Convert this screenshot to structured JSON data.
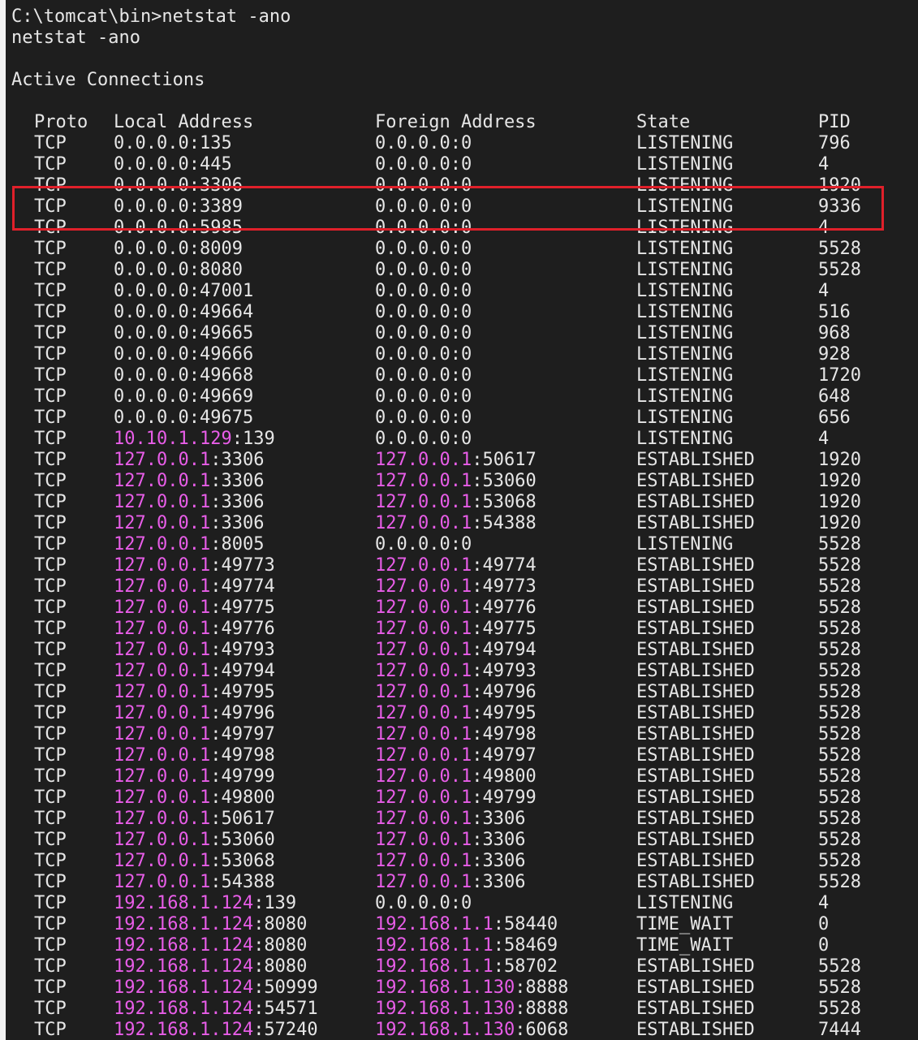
{
  "window": {
    "prompt_line": "C:\\tomcat\\bin>netstat -ano",
    "echo_line": "netstat -ano",
    "section_title": "Active Connections"
  },
  "table": {
    "headers": [
      "Proto",
      "Local Address",
      "Foreign Address",
      "State",
      "PID"
    ],
    "highlighted_row_index": 3,
    "highlight_color": "#e0202a",
    "address_ip_color": "#e85de8",
    "rows": [
      {
        "proto": "TCP",
        "local_ip": "",
        "local_rest": "0.0.0.0:135",
        "foreign_ip": "",
        "foreign_rest": "0.0.0.0:0",
        "state": "LISTENING",
        "pid": "796"
      },
      {
        "proto": "TCP",
        "local_ip": "",
        "local_rest": "0.0.0.0:445",
        "foreign_ip": "",
        "foreign_rest": "0.0.0.0:0",
        "state": "LISTENING",
        "pid": "4"
      },
      {
        "proto": "TCP",
        "local_ip": "",
        "local_rest": "0.0.0.0:3306",
        "foreign_ip": "",
        "foreign_rest": "0.0.0.0:0",
        "state": "LISTENING",
        "pid": "1920"
      },
      {
        "proto": "TCP",
        "local_ip": "",
        "local_rest": "0.0.0.0:3389",
        "foreign_ip": "",
        "foreign_rest": "0.0.0.0:0",
        "state": "LISTENING",
        "pid": "9336"
      },
      {
        "proto": "TCP",
        "local_ip": "",
        "local_rest": "0.0.0.0:5985",
        "foreign_ip": "",
        "foreign_rest": "0.0.0.0:0",
        "state": "LISTENING",
        "pid": "4"
      },
      {
        "proto": "TCP",
        "local_ip": "",
        "local_rest": "0.0.0.0:8009",
        "foreign_ip": "",
        "foreign_rest": "0.0.0.0:0",
        "state": "LISTENING",
        "pid": "5528"
      },
      {
        "proto": "TCP",
        "local_ip": "",
        "local_rest": "0.0.0.0:8080",
        "foreign_ip": "",
        "foreign_rest": "0.0.0.0:0",
        "state": "LISTENING",
        "pid": "5528"
      },
      {
        "proto": "TCP",
        "local_ip": "",
        "local_rest": "0.0.0.0:47001",
        "foreign_ip": "",
        "foreign_rest": "0.0.0.0:0",
        "state": "LISTENING",
        "pid": "4"
      },
      {
        "proto": "TCP",
        "local_ip": "",
        "local_rest": "0.0.0.0:49664",
        "foreign_ip": "",
        "foreign_rest": "0.0.0.0:0",
        "state": "LISTENING",
        "pid": "516"
      },
      {
        "proto": "TCP",
        "local_ip": "",
        "local_rest": "0.0.0.0:49665",
        "foreign_ip": "",
        "foreign_rest": "0.0.0.0:0",
        "state": "LISTENING",
        "pid": "968"
      },
      {
        "proto": "TCP",
        "local_ip": "",
        "local_rest": "0.0.0.0:49666",
        "foreign_ip": "",
        "foreign_rest": "0.0.0.0:0",
        "state": "LISTENING",
        "pid": "928"
      },
      {
        "proto": "TCP",
        "local_ip": "",
        "local_rest": "0.0.0.0:49668",
        "foreign_ip": "",
        "foreign_rest": "0.0.0.0:0",
        "state": "LISTENING",
        "pid": "1720"
      },
      {
        "proto": "TCP",
        "local_ip": "",
        "local_rest": "0.0.0.0:49669",
        "foreign_ip": "",
        "foreign_rest": "0.0.0.0:0",
        "state": "LISTENING",
        "pid": "648"
      },
      {
        "proto": "TCP",
        "local_ip": "",
        "local_rest": "0.0.0.0:49675",
        "foreign_ip": "",
        "foreign_rest": "0.0.0.0:0",
        "state": "LISTENING",
        "pid": "656"
      },
      {
        "proto": "TCP",
        "local_ip": "10.10.1.129",
        "local_rest": ":139",
        "foreign_ip": "",
        "foreign_rest": "0.0.0.0:0",
        "state": "LISTENING",
        "pid": "4"
      },
      {
        "proto": "TCP",
        "local_ip": "127.0.0.1",
        "local_rest": ":3306",
        "foreign_ip": "127.0.0.1",
        "foreign_rest": ":50617",
        "state": "ESTABLISHED",
        "pid": "1920"
      },
      {
        "proto": "TCP",
        "local_ip": "127.0.0.1",
        "local_rest": ":3306",
        "foreign_ip": "127.0.0.1",
        "foreign_rest": ":53060",
        "state": "ESTABLISHED",
        "pid": "1920"
      },
      {
        "proto": "TCP",
        "local_ip": "127.0.0.1",
        "local_rest": ":3306",
        "foreign_ip": "127.0.0.1",
        "foreign_rest": ":53068",
        "state": "ESTABLISHED",
        "pid": "1920"
      },
      {
        "proto": "TCP",
        "local_ip": "127.0.0.1",
        "local_rest": ":3306",
        "foreign_ip": "127.0.0.1",
        "foreign_rest": ":54388",
        "state": "ESTABLISHED",
        "pid": "1920"
      },
      {
        "proto": "TCP",
        "local_ip": "127.0.0.1",
        "local_rest": ":8005",
        "foreign_ip": "",
        "foreign_rest": "0.0.0.0:0",
        "state": "LISTENING",
        "pid": "5528"
      },
      {
        "proto": "TCP",
        "local_ip": "127.0.0.1",
        "local_rest": ":49773",
        "foreign_ip": "127.0.0.1",
        "foreign_rest": ":49774",
        "state": "ESTABLISHED",
        "pid": "5528"
      },
      {
        "proto": "TCP",
        "local_ip": "127.0.0.1",
        "local_rest": ":49774",
        "foreign_ip": "127.0.0.1",
        "foreign_rest": ":49773",
        "state": "ESTABLISHED",
        "pid": "5528"
      },
      {
        "proto": "TCP",
        "local_ip": "127.0.0.1",
        "local_rest": ":49775",
        "foreign_ip": "127.0.0.1",
        "foreign_rest": ":49776",
        "state": "ESTABLISHED",
        "pid": "5528"
      },
      {
        "proto": "TCP",
        "local_ip": "127.0.0.1",
        "local_rest": ":49776",
        "foreign_ip": "127.0.0.1",
        "foreign_rest": ":49775",
        "state": "ESTABLISHED",
        "pid": "5528"
      },
      {
        "proto": "TCP",
        "local_ip": "127.0.0.1",
        "local_rest": ":49793",
        "foreign_ip": "127.0.0.1",
        "foreign_rest": ":49794",
        "state": "ESTABLISHED",
        "pid": "5528"
      },
      {
        "proto": "TCP",
        "local_ip": "127.0.0.1",
        "local_rest": ":49794",
        "foreign_ip": "127.0.0.1",
        "foreign_rest": ":49793",
        "state": "ESTABLISHED",
        "pid": "5528"
      },
      {
        "proto": "TCP",
        "local_ip": "127.0.0.1",
        "local_rest": ":49795",
        "foreign_ip": "127.0.0.1",
        "foreign_rest": ":49796",
        "state": "ESTABLISHED",
        "pid": "5528"
      },
      {
        "proto": "TCP",
        "local_ip": "127.0.0.1",
        "local_rest": ":49796",
        "foreign_ip": "127.0.0.1",
        "foreign_rest": ":49795",
        "state": "ESTABLISHED",
        "pid": "5528"
      },
      {
        "proto": "TCP",
        "local_ip": "127.0.0.1",
        "local_rest": ":49797",
        "foreign_ip": "127.0.0.1",
        "foreign_rest": ":49798",
        "state": "ESTABLISHED",
        "pid": "5528"
      },
      {
        "proto": "TCP",
        "local_ip": "127.0.0.1",
        "local_rest": ":49798",
        "foreign_ip": "127.0.0.1",
        "foreign_rest": ":49797",
        "state": "ESTABLISHED",
        "pid": "5528"
      },
      {
        "proto": "TCP",
        "local_ip": "127.0.0.1",
        "local_rest": ":49799",
        "foreign_ip": "127.0.0.1",
        "foreign_rest": ":49800",
        "state": "ESTABLISHED",
        "pid": "5528"
      },
      {
        "proto": "TCP",
        "local_ip": "127.0.0.1",
        "local_rest": ":49800",
        "foreign_ip": "127.0.0.1",
        "foreign_rest": ":49799",
        "state": "ESTABLISHED",
        "pid": "5528"
      },
      {
        "proto": "TCP",
        "local_ip": "127.0.0.1",
        "local_rest": ":50617",
        "foreign_ip": "127.0.0.1",
        "foreign_rest": ":3306",
        "state": "ESTABLISHED",
        "pid": "5528"
      },
      {
        "proto": "TCP",
        "local_ip": "127.0.0.1",
        "local_rest": ":53060",
        "foreign_ip": "127.0.0.1",
        "foreign_rest": ":3306",
        "state": "ESTABLISHED",
        "pid": "5528"
      },
      {
        "proto": "TCP",
        "local_ip": "127.0.0.1",
        "local_rest": ":53068",
        "foreign_ip": "127.0.0.1",
        "foreign_rest": ":3306",
        "state": "ESTABLISHED",
        "pid": "5528"
      },
      {
        "proto": "TCP",
        "local_ip": "127.0.0.1",
        "local_rest": ":54388",
        "foreign_ip": "127.0.0.1",
        "foreign_rest": ":3306",
        "state": "ESTABLISHED",
        "pid": "5528"
      },
      {
        "proto": "TCP",
        "local_ip": "192.168.1.124",
        "local_rest": ":139",
        "foreign_ip": "",
        "foreign_rest": "0.0.0.0:0",
        "state": "LISTENING",
        "pid": "4"
      },
      {
        "proto": "TCP",
        "local_ip": "192.168.1.124",
        "local_rest": ":8080",
        "foreign_ip": "192.168.1.1",
        "foreign_rest": ":58440",
        "state": "TIME_WAIT",
        "pid": "0"
      },
      {
        "proto": "TCP",
        "local_ip": "192.168.1.124",
        "local_rest": ":8080",
        "foreign_ip": "192.168.1.1",
        "foreign_rest": ":58469",
        "state": "TIME_WAIT",
        "pid": "0"
      },
      {
        "proto": "TCP",
        "local_ip": "192.168.1.124",
        "local_rest": ":8080",
        "foreign_ip": "192.168.1.1",
        "foreign_rest": ":58702",
        "state": "ESTABLISHED",
        "pid": "5528"
      },
      {
        "proto": "TCP",
        "local_ip": "192.168.1.124",
        "local_rest": ":50999",
        "foreign_ip": "192.168.1.130",
        "foreign_rest": ":8888",
        "state": "ESTABLISHED",
        "pid": "5528"
      },
      {
        "proto": "TCP",
        "local_ip": "192.168.1.124",
        "local_rest": ":54571",
        "foreign_ip": "192.168.1.130",
        "foreign_rest": ":8888",
        "state": "ESTABLISHED",
        "pid": "5528"
      },
      {
        "proto": "TCP",
        "local_ip": "192.168.1.124",
        "local_rest": ":57240",
        "foreign_ip": "192.168.1.130",
        "foreign_rest": ":6068",
        "state": "ESTABLISHED",
        "pid": "7444"
      }
    ]
  }
}
